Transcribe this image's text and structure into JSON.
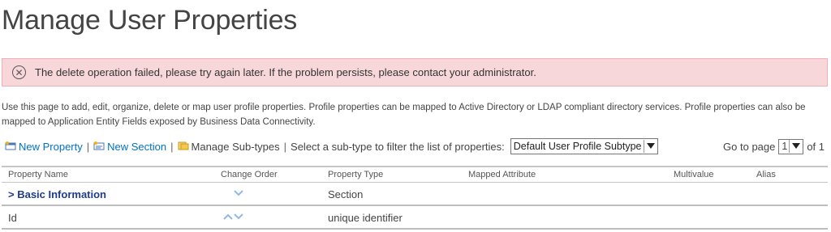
{
  "page": {
    "title": "Manage User Properties"
  },
  "error": {
    "message": "The delete operation failed, please try again later. If the problem persists, please contact your administrator."
  },
  "description": "Use this page to add, edit, organize, delete or map user profile properties. Profile properties can be mapped to Active Directory or LDAP compliant directory services. Profile properties can also be mapped to Application Entity Fields exposed by Business Data Connectivity.",
  "toolbar": {
    "new_property": "New Property",
    "new_section": "New Section",
    "manage_subtypes": "Manage Sub-types",
    "separator": "|",
    "filter_label": "Select a sub-type to filter the list of properties:",
    "subtype_selected": "Default User Profile Subtype"
  },
  "pager": {
    "go_to_page": "Go to page",
    "current_page": "1",
    "of_total": "of 1"
  },
  "table": {
    "columns": [
      "Property Name",
      "Change Order",
      "Property Type",
      "Mapped Attribute",
      "Multivalue",
      "Alias"
    ],
    "rows": [
      {
        "name": "> Basic Information",
        "type": "Section",
        "is_section": true,
        "order": [
          "down"
        ]
      },
      {
        "name": "Id",
        "type": "unique identifier",
        "is_section": false,
        "order": [
          "up",
          "down"
        ]
      }
    ]
  },
  "colors": {
    "link": "#0072c6",
    "error_bg": "#f8d7da",
    "section_text": "#1f3b8c",
    "chevron": "#8fb9e8"
  },
  "icons": [
    "error-circle-x-icon",
    "new-property-icon",
    "new-section-icon",
    "manage-subtypes-icon",
    "chevron-down-icon",
    "chevron-up-icon"
  ]
}
